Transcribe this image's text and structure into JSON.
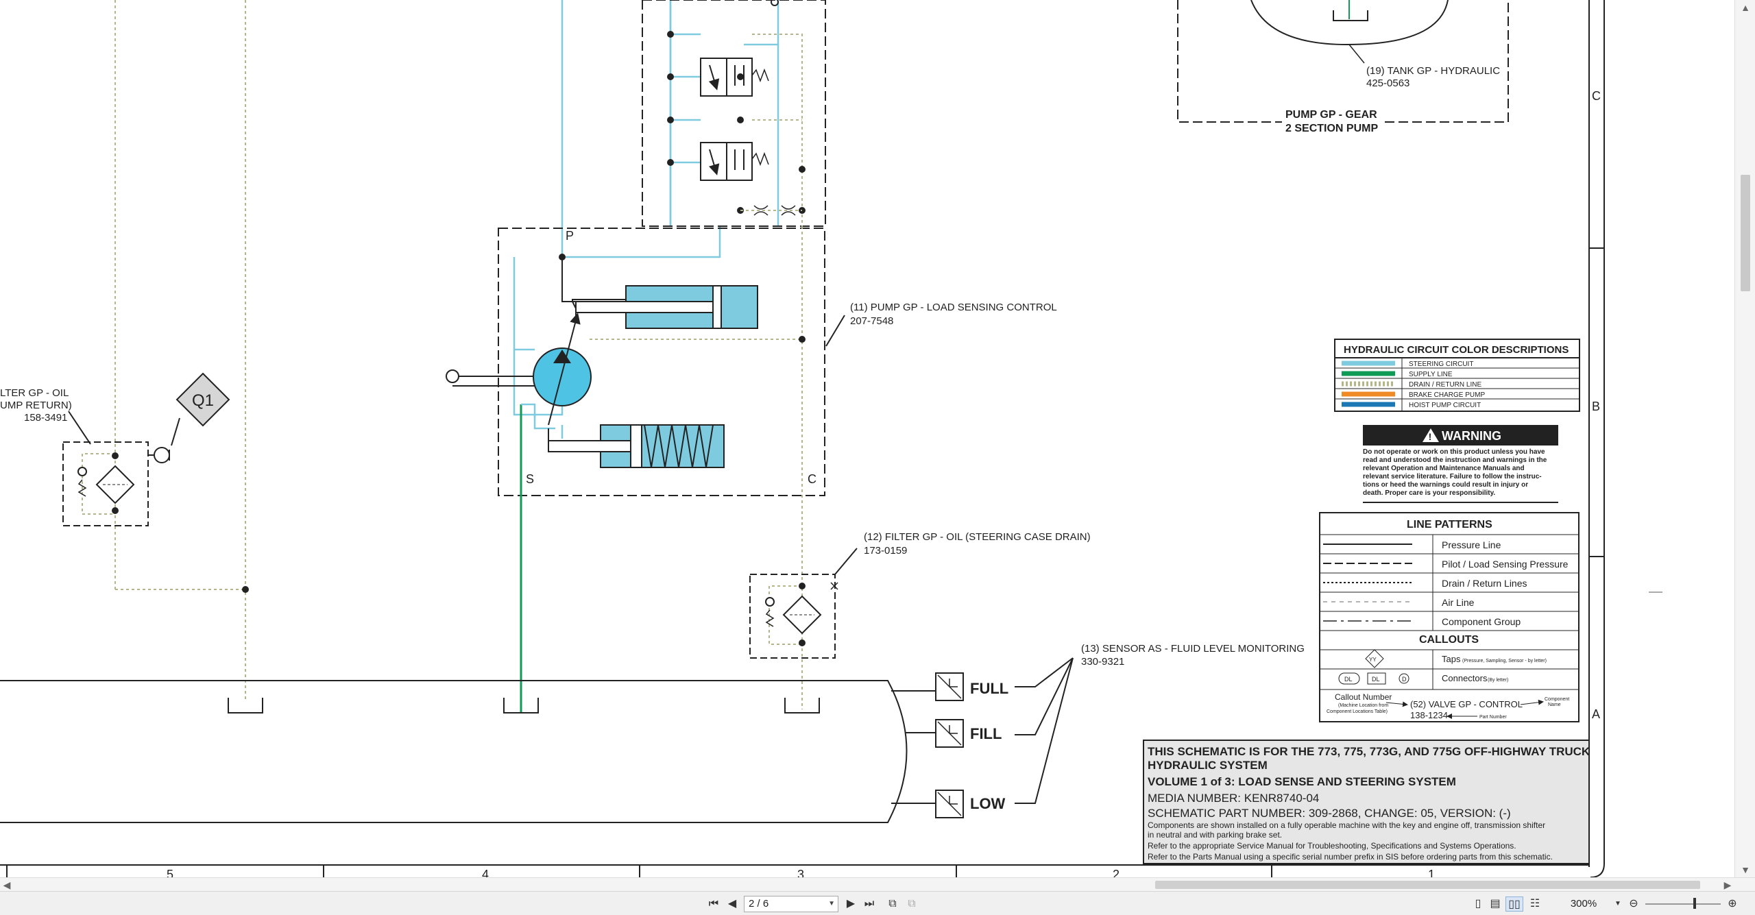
{
  "viewer": {
    "page_indicator": "2 / 6",
    "zoom": "300%"
  },
  "schematic": {
    "tank_label_1": "(19) TANK GP - HYDRAULIC",
    "tank_label_2": "425-0563",
    "pump_group_1": "PUMP GP - GEAR",
    "pump_group_2": "2 SECTION PUMP",
    "pump_ls_1": "(11) PUMP GP - LOAD SENSING CONTROL",
    "pump_ls_2": "207-7548",
    "port_p": "P",
    "port_s": "S",
    "port_c": "C",
    "filter_left_1": "LTER GP - OIL",
    "filter_left_2": "UMP RETURN)",
    "filter_left_3": "158-3491",
    "q1": "Q1",
    "filter_12_1": "(12) FILTER GP - OIL (STEERING CASE DRAIN)",
    "filter_12_2": "173-0159",
    "sensor_13_1": "(13) SENSOR AS - FLUID LEVEL MONITORING",
    "sensor_13_2": "330-9321",
    "level_full": "FULL",
    "level_fill": "FILL",
    "level_low": "LOW",
    "zone_c": "C",
    "zone_b": "B",
    "zone_a": "A",
    "grid_5": "5",
    "grid_4": "4",
    "grid_3": "3",
    "grid_2": "2",
    "grid_1": "1"
  },
  "legend": {
    "title": "HYDRAULIC CIRCUIT COLOR DESCRIPTIONS",
    "items": [
      {
        "label": "STEERING CIRCUIT",
        "color": "#7ecbe0"
      },
      {
        "label": "SUPPLY LINE",
        "color": "#0f9a55"
      },
      {
        "label": "DRAIN / RETURN LINE",
        "color": "#b5b58a"
      },
      {
        "label": "BRAKE CHARGE PUMP",
        "color": "#f08a24"
      },
      {
        "label": "HOIST PUMP CIRCUIT",
        "color": "#1b78b5"
      }
    ]
  },
  "warning": {
    "title": "WARNING",
    "lines": [
      "Do not operate or work on this product unless you have",
      "read and understood the instruction and warnings in the",
      "relevant Operation and Maintenance Manuals and",
      "relevant service literature. Failure to follow the instruc-",
      "tions or heed the warnings could result in injury or",
      "death. Proper care is your responsibility."
    ]
  },
  "line_patterns": {
    "title": "LINE PATTERNS",
    "items": [
      "Pressure Line",
      "Pilot / Load Sensing Pressure",
      "Drain / Return Lines",
      "Air Line",
      "Component Group"
    ],
    "callouts_title": "CALLOUTS",
    "taps_label": "Taps",
    "taps_note": "(Pressure, Sampling, Sensor - by letter)",
    "taps_symbol": "YY",
    "connectors_label": "Connectors",
    "connectors_note": "(By letter)",
    "connector_symbol": "DL",
    "connector_symbol_3": "D",
    "callout_number": "Callout Number",
    "callout_note_1": "(Machine Location from",
    "callout_note_2": "Component Locations Table)",
    "example_name": "(52) VALVE GP - CONTROL",
    "example_part": "138-1234",
    "component_name_1": "Component",
    "component_name_2": "Name",
    "part_number": "Part Number"
  },
  "title_block": {
    "line1": "THIS SCHEMATIC IS FOR THE 773, 775, 773G, AND 775G OFF-HIGHWAY TRUCK",
    "line2": "HYDRAULIC SYSTEM",
    "line3": "VOLUME 1 of 3: LOAD SENSE AND STEERING SYSTEM",
    "media": "MEDIA NUMBER: KENR8740-04",
    "part": "SCHEMATIC PART NUMBER: 309-2868, CHANGE: 05, VERSION: (-)",
    "note1": "Components are shown installed on a fully operable machine with the key and engine off, transmission shifter",
    "note2": "in neutral and with parking brake set.",
    "note3": "Refer to the appropriate Service Manual for Troubleshooting, Specifications and Systems Operations.",
    "note4": "Refer to the Parts Manual using a specific serial number prefix in SIS before ordering parts from this schematic."
  },
  "icons": {
    "first_page": "first-page-icon",
    "prev_page": "prev-page-icon",
    "next_page": "next-page-icon",
    "last_page": "last-page-icon",
    "zoom_out": "zoom-out-icon",
    "zoom_in": "zoom-in-icon"
  }
}
